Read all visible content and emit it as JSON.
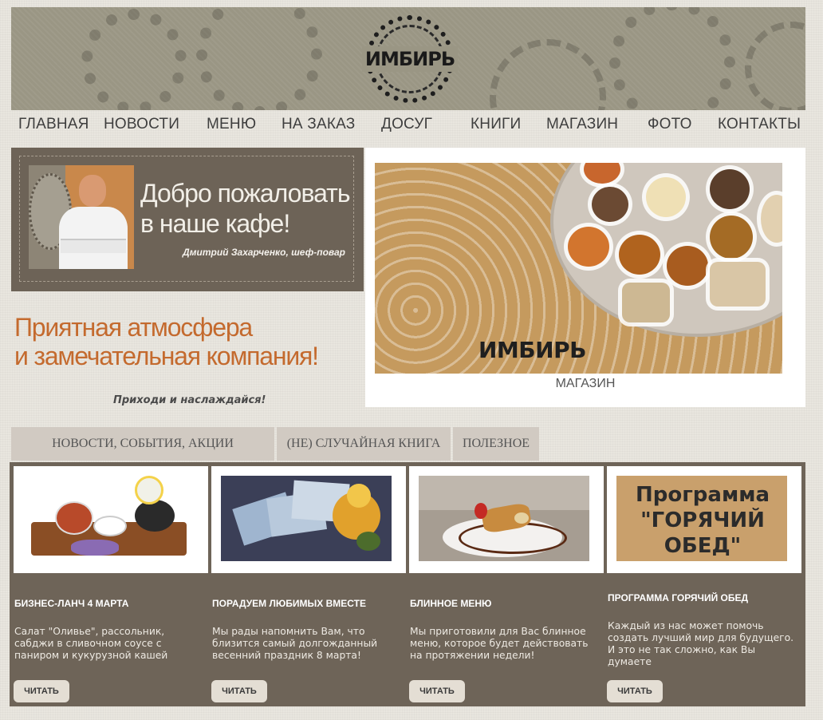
{
  "brand": {
    "logo_text": "ИМБИРЬ"
  },
  "nav": {
    "items": [
      "ГЛАВНАЯ",
      "НОВОСТИ",
      "МЕНЮ",
      "НА ЗАКАЗ",
      "ДОСУГ",
      "КНИГИ",
      "МАГАЗИН",
      "ФОТО",
      "КОНТАКТЫ"
    ]
  },
  "welcome": {
    "title_line1": "Добро пожаловать",
    "title_line2": "в наше кафе!",
    "signature": "Дмитрий Захарченко, шеф-повар"
  },
  "tagline": {
    "line1": "Приятная атмосфера",
    "line2": "и замечательная компания!",
    "motto": "Приходи и наслаждайся!"
  },
  "shop": {
    "image_brand": "ИМБИРЬ",
    "caption": "МАГАЗИН"
  },
  "tabs": [
    "НОВОСТИ, СОБЫТИЯ, АКЦИИ",
    "(НЕ) СЛУЧАЙНАЯ КНИГА",
    "ПОЛЕЗНОЕ"
  ],
  "cards": [
    {
      "title": "БИЗНЕС-ЛАНЧ 4 МАРТА",
      "text": "Салат \"Оливье\", рассольник, сабджи в сливочном соусе с паниром и кукурузной кашей",
      "button": "ЧИТАТЬ"
    },
    {
      "title": "ПОРАДУЕМ ЛЮБИМЫХ ВМЕСТЕ",
      "text": "Мы рады напомнить Вам, что близится самый долгожданный весенний праздник 8 марта!",
      "button": "ЧИТАТЬ"
    },
    {
      "title": "БЛИННОЕ МЕНЮ",
      "text": "Мы приготовили для Вас блинное меню, которое будет действовать на протяжении недели!",
      "button": "ЧИТАТЬ"
    },
    {
      "title": "ПРОГРАММА ГОРЯЧИЙ ОБЕД",
      "text": "Каждый из нас может помочь создать лучший мир для будущего. И это не так сложно, как Вы думаете",
      "button": "ЧИТАТЬ",
      "image_text": "Программа \"ГОРЯЧИЙ ОБЕД\""
    }
  ]
}
